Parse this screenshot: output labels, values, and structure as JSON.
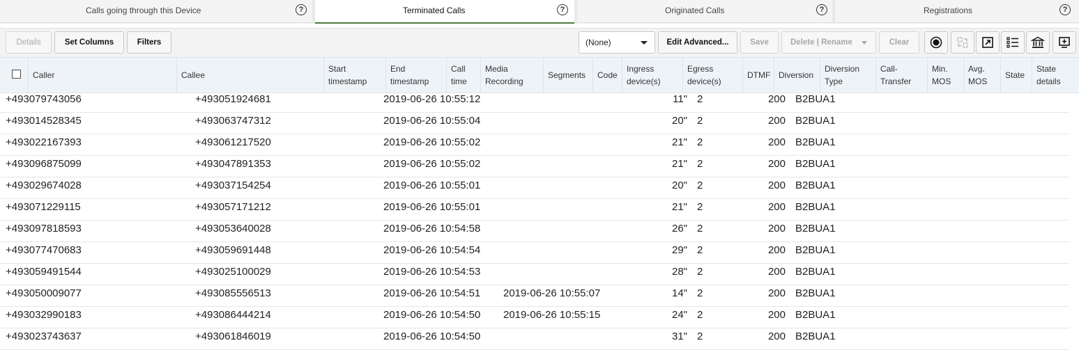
{
  "tabs": [
    {
      "label": "Calls going through this Device",
      "active": false
    },
    {
      "label": "Terminated Calls",
      "active": true
    },
    {
      "label": "Originated Calls",
      "active": false
    },
    {
      "label": "Registrations",
      "active": false
    }
  ],
  "help_glyph": "?",
  "toolbar": {
    "details": "Details",
    "set_columns": "Set Columns",
    "filters": "Filters",
    "select_value": "(None)",
    "edit_advanced": "Edit Advanced...",
    "save": "Save",
    "delete_rename": "Delete | Rename",
    "clear": "Clear",
    "icons": [
      "record-icon",
      "transfer-icon",
      "export-icon",
      "list-icon",
      "bank-icon",
      "add-screen-icon"
    ]
  },
  "columns": {
    "caller": "Caller",
    "callee": "Callee",
    "start_1": "Start",
    "start_2": "timestamp",
    "end_1": "End",
    "end_2": "timestamp",
    "calltime_1": "Call",
    "calltime_2": "time",
    "media_1": "Media",
    "media_2": "Recording",
    "segments": "Segments",
    "code": "Code",
    "ingress_1": "Ingress",
    "ingress_2": "device(s)",
    "egress_1": "Egress",
    "egress_2": "device(s)",
    "dtmf": "DTMF",
    "diversion": "Diversion",
    "divtype_1": "Diversion",
    "divtype_2": "Type",
    "transfer_1": "Call-",
    "transfer_2": "Transfer",
    "minmos_1": "Min.",
    "minmos_2": "MOS",
    "avgmos_1": "Avg.",
    "avgmos_2": "MOS",
    "state": "State",
    "statedet_1": "State",
    "statedet_2": "details"
  },
  "rows": [
    {
      "caller": "+493079743056",
      "callee": "+493051924681",
      "start": "2019-06-26 10:55:12",
      "end": "",
      "calltime": "11\"",
      "segments": "2",
      "code": "200",
      "device": "B2BUA1"
    },
    {
      "caller": "+493014528345",
      "callee": "+493063747312",
      "start": "2019-06-26 10:55:04",
      "end": "",
      "calltime": "20\"",
      "segments": "2",
      "code": "200",
      "device": "B2BUA1"
    },
    {
      "caller": "+493022167393",
      "callee": "+493061217520",
      "start": "2019-06-26 10:55:02",
      "end": "",
      "calltime": "21\"",
      "segments": "2",
      "code": "200",
      "device": "B2BUA1"
    },
    {
      "caller": "+493096875099",
      "callee": "+493047891353",
      "start": "2019-06-26 10:55:02",
      "end": "",
      "calltime": "21\"",
      "segments": "2",
      "code": "200",
      "device": "B2BUA1"
    },
    {
      "caller": "+493029674028",
      "callee": "+493037154254",
      "start": "2019-06-26 10:55:01",
      "end": "",
      "calltime": "20\"",
      "segments": "2",
      "code": "200",
      "device": "B2BUA1"
    },
    {
      "caller": "+493071229115",
      "callee": "+493057171212",
      "start": "2019-06-26 10:55:01",
      "end": "",
      "calltime": "21\"",
      "segments": "2",
      "code": "200",
      "device": "B2BUA1"
    },
    {
      "caller": "+493097818593",
      "callee": "+493053640028",
      "start": "2019-06-26 10:54:58",
      "end": "",
      "calltime": "26\"",
      "segments": "2",
      "code": "200",
      "device": "B2BUA1"
    },
    {
      "caller": "+493077470683",
      "callee": "+493059691448",
      "start": "2019-06-26 10:54:54",
      "end": "",
      "calltime": "29\"",
      "segments": "2",
      "code": "200",
      "device": "B2BUA1"
    },
    {
      "caller": "+493059491544",
      "callee": "+493025100029",
      "start": "2019-06-26 10:54:53",
      "end": "",
      "calltime": "28\"",
      "segments": "2",
      "code": "200",
      "device": "B2BUA1"
    },
    {
      "caller": "+493050009077",
      "callee": "+493085556513",
      "start": "2019-06-26 10:54:51",
      "end": "2019-06-26 10:55:07",
      "calltime": "14\"",
      "segments": "2",
      "code": "200",
      "device": "B2BUA1"
    },
    {
      "caller": "+493032990183",
      "callee": "+493086444214",
      "start": "2019-06-26 10:54:50",
      "end": "2019-06-26 10:55:15",
      "calltime": "24\"",
      "segments": "2",
      "code": "200",
      "device": "B2BUA1"
    },
    {
      "caller": "+493023743637",
      "callee": "+493061846019",
      "start": "2019-06-26 10:54:50",
      "end": "",
      "calltime": "31\"",
      "segments": "2",
      "code": "200",
      "device": "B2BUA1"
    }
  ],
  "colors": {
    "active_tab_underline": "#4a7a3c",
    "header_bg": "#eef3f8"
  }
}
